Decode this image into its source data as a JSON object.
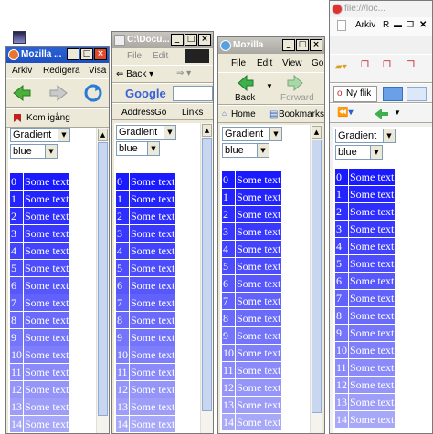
{
  "taskbar_label": "Mozilla ...",
  "windows": {
    "w1": {
      "title": "Mozilla ...",
      "menu": [
        "Arkiv",
        "Redigera",
        "Visa"
      ],
      "bookmark": "Kom igång"
    },
    "w2": {
      "title": "C:\\Docu...",
      "menu": [
        "File",
        "Edit"
      ],
      "back": "Back",
      "address": "Address",
      "go": "Go",
      "links": "Links",
      "google": "Google"
    },
    "w3": {
      "title": "Mozilla",
      "menu": [
        "File",
        "Edit",
        "View",
        "Go"
      ],
      "back": "Back",
      "forward": "Forward",
      "home": "Home",
      "bookmarks": "Bookmarks"
    },
    "w4": {
      "title": "file:///loc...",
      "menu": [
        "Arkiv",
        "R"
      ],
      "tab": "Ny flik"
    }
  },
  "controls": {
    "gradient": "Gradient",
    "color": "blue"
  },
  "rows": [
    {
      "n": "0",
      "text": "Some text"
    },
    {
      "n": "1",
      "text": "Some text"
    },
    {
      "n": "2",
      "text": "Some text"
    },
    {
      "n": "3",
      "text": "Some text"
    },
    {
      "n": "4",
      "text": "Some text"
    },
    {
      "n": "5",
      "text": "Some text"
    },
    {
      "n": "6",
      "text": "Some text"
    },
    {
      "n": "7",
      "text": "Some text"
    },
    {
      "n": "8",
      "text": "Some text"
    },
    {
      "n": "9",
      "text": "Some text"
    },
    {
      "n": "10",
      "text": "Some text"
    },
    {
      "n": "11",
      "text": "Some text"
    },
    {
      "n": "12",
      "text": "Some text"
    },
    {
      "n": "13",
      "text": "Some text"
    },
    {
      "n": "14",
      "text": "Some text"
    }
  ],
  "colors": {
    "row_start": "#1a1aff",
    "row_end": "#a8a8f8",
    "xp_blue": "#2a63d8"
  }
}
